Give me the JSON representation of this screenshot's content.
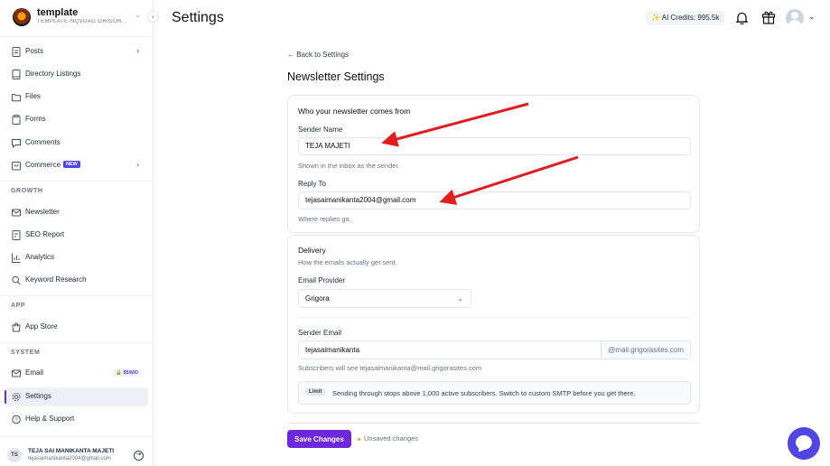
{
  "workspace": {
    "name": "template",
    "slug": "TEMPLATE-NQVDAG.GRIGOR..."
  },
  "sidebar": {
    "items_top": [
      {
        "label": "Posts",
        "icon": "document-icon",
        "chevron": true
      },
      {
        "label": "Directory Listings",
        "icon": "book-icon"
      },
      {
        "label": "Files",
        "icon": "folder-icon"
      },
      {
        "label": "Forms",
        "icon": "clipboard-icon"
      },
      {
        "label": "Comments",
        "icon": "comment-icon"
      },
      {
        "label": "Commerce",
        "icon": "cart-icon",
        "badge": "NEW",
        "chevron": true
      }
    ],
    "growth_label": "GROWTH",
    "items_growth": [
      {
        "label": "Newsletter",
        "icon": "mail-icon"
      },
      {
        "label": "SEO Report",
        "icon": "report-icon"
      },
      {
        "label": "Analytics",
        "icon": "analytics-icon"
      },
      {
        "label": "Keyword Research",
        "icon": "search-icon"
      }
    ],
    "app_label": "APP",
    "items_app": [
      {
        "label": "App Store",
        "icon": "store-icon"
      }
    ],
    "system_label": "SYSTEM",
    "items_system": [
      {
        "label": "Email",
        "icon": "mail-icon",
        "badge": "$5/MO"
      },
      {
        "label": "Settings",
        "icon": "gear-icon",
        "active": true
      },
      {
        "label": "Help & Support",
        "icon": "help-icon"
      }
    ],
    "user": {
      "initials": "TS",
      "name": "TEJA SAI MANIKANTA MAJETI",
      "email": "tejasaimanikanta2004@gmail.com"
    }
  },
  "header": {
    "title": "Settings",
    "credits": "AI Credits: 995.5k"
  },
  "content": {
    "back_link": "Back to Settings",
    "page_title": "Newsletter Settings",
    "from_card": {
      "heading": "Who your newsletter comes from",
      "sender_name_label": "Sender Name",
      "sender_name_value": "TEJA MAJETI",
      "sender_name_hint": "Shown in the inbox as the sender.",
      "reply_to_label": "Reply To",
      "reply_to_value": "tejasaimanikanta2004@gmail.com",
      "reply_to_hint": "Where replies go."
    },
    "delivery_card": {
      "heading": "Delivery",
      "subheading": "How the emails actually get sent.",
      "provider_label": "Email Provider",
      "provider_value": "Grigora",
      "sender_email_label": "Sender Email",
      "sender_email_local": "tejasaimanikanta",
      "sender_email_domain": "@mail.grigorasites.com",
      "sender_email_hint": "Subscribers will see tejasaimanikanta@mail.grigorasites.com",
      "limit_tag": "Limit",
      "limit_message": "Sending through stops above 1,000 active subscribers. Switch to custom SMTP before you get there."
    },
    "save_label": "Save Changes",
    "unsaved_label": "Unsaved changes"
  },
  "colors": {
    "accent": "#6d28d9",
    "annotation_arrow": "#e11d1d"
  }
}
